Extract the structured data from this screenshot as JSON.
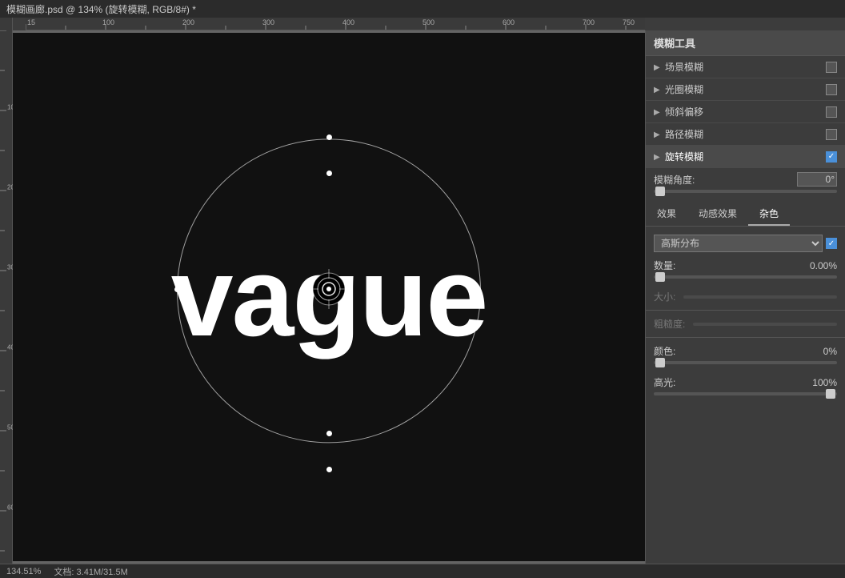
{
  "titlebar": {
    "title": "模糊画廊.psd @ 134% (旋转模糊, RGB/8#) *"
  },
  "panel": {
    "title": "模糊工具",
    "items": [
      {
        "label": "场景模糊",
        "checked": false
      },
      {
        "label": "光圈模糊",
        "checked": false
      },
      {
        "label": "倾斜偏移",
        "checked": false
      },
      {
        "label": "路径模糊",
        "checked": false
      },
      {
        "label": "旋转模糊",
        "checked": true
      }
    ],
    "blur_angle_label": "模糊角度:",
    "blur_angle_value": "0°",
    "tabs": [
      "效果",
      "动感效果",
      "杂色"
    ],
    "active_tab": "杂色",
    "noise": {
      "distribution_label": "高斯分布",
      "distribution_checked": true,
      "amount_label": "数量:",
      "amount_value": "0.00%",
      "size_label": "大小:",
      "roughness_label": "粗糙度:",
      "color_label": "颜色:",
      "color_value": "0%",
      "highlight_label": "高光:",
      "highlight_value": "100%"
    }
  },
  "canvas": {
    "text": "vague"
  },
  "statusbar": {
    "zoom": "134.51%",
    "info": "文档: 3.41M/31.5M"
  }
}
